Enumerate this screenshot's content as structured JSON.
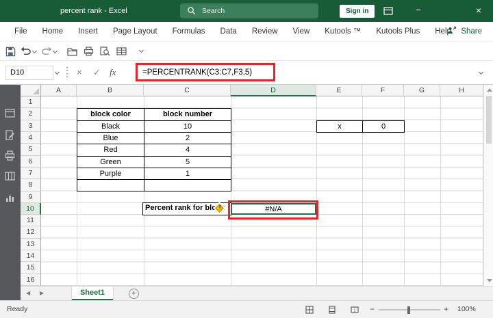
{
  "titlebar": {
    "title": "percent rank - Excel",
    "search_label": "Search",
    "signin_label": "Sign in",
    "minimize_glyph": "−",
    "close_glyph": "×"
  },
  "menubar": {
    "tabs": [
      "File",
      "Home",
      "Insert",
      "Page Layout",
      "Formulas",
      "Data",
      "Review",
      "View",
      "Kutools ™",
      "Kutools Plus",
      "Help"
    ],
    "share_label": "Share"
  },
  "formula_bar": {
    "name_box_value": "D10",
    "cancel_glyph": "×",
    "enter_glyph": "✓",
    "fx_label": "fx",
    "formula": "=PERCENTRANK(C3:C7,F3,5)"
  },
  "grid": {
    "column_headers": [
      "A",
      "B",
      "C",
      "D",
      "E",
      "F",
      "G",
      "H"
    ],
    "row_headers": [
      "1",
      "2",
      "3",
      "4",
      "5",
      "6",
      "7",
      "8",
      "9",
      "10",
      "11",
      "12",
      "13",
      "14",
      "15",
      "16"
    ],
    "selected_cell": "D10",
    "selected_column": "D",
    "selected_row": "10"
  },
  "block_table": {
    "headers": [
      "block color",
      "block number"
    ],
    "rows": [
      [
        "Black",
        "10"
      ],
      [
        "Blue",
        "2"
      ],
      [
        "Red",
        "4"
      ],
      [
        "Green",
        "5"
      ],
      [
        "Purple",
        "1"
      ],
      [
        "",
        ""
      ]
    ]
  },
  "lookup_cells": {
    "label": "x",
    "value": "0"
  },
  "result": {
    "label": "Percent rank for block",
    "value": "#N/A",
    "warning_glyph": "!"
  },
  "sheet_bar": {
    "prev_glyph": "◀",
    "next_glyph": "▶",
    "active_tab": "Sheet1",
    "add_glyph": "+"
  },
  "status_bar": {
    "mode": "Ready",
    "zoom_out": "−",
    "zoom_in": "+",
    "zoom_level": "100%"
  },
  "colors": {
    "titlebar": "#185C37",
    "accent": "#217346",
    "annotation": "#E8232A",
    "selection": "#1E7145"
  }
}
